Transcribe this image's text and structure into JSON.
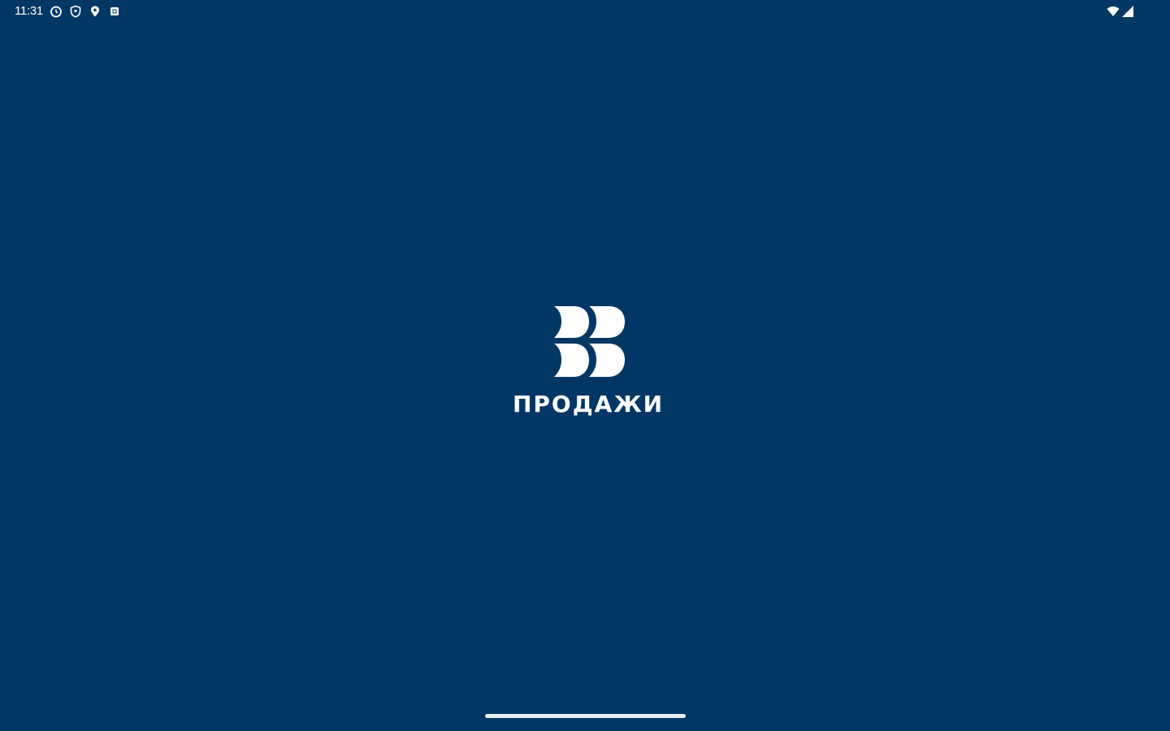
{
  "status_bar": {
    "time": "11:31",
    "left_icons": [
      "alarm-icon",
      "shield-icon",
      "location-icon",
      "notification-square-icon"
    ],
    "right_icons": [
      "wifi-icon",
      "cellular-signal-icon"
    ]
  },
  "splash": {
    "logo": "brand-logo-mark",
    "app_name": "ПРОДАЖИ"
  },
  "colors": {
    "background": "#003764",
    "foreground": "#ffffff"
  }
}
